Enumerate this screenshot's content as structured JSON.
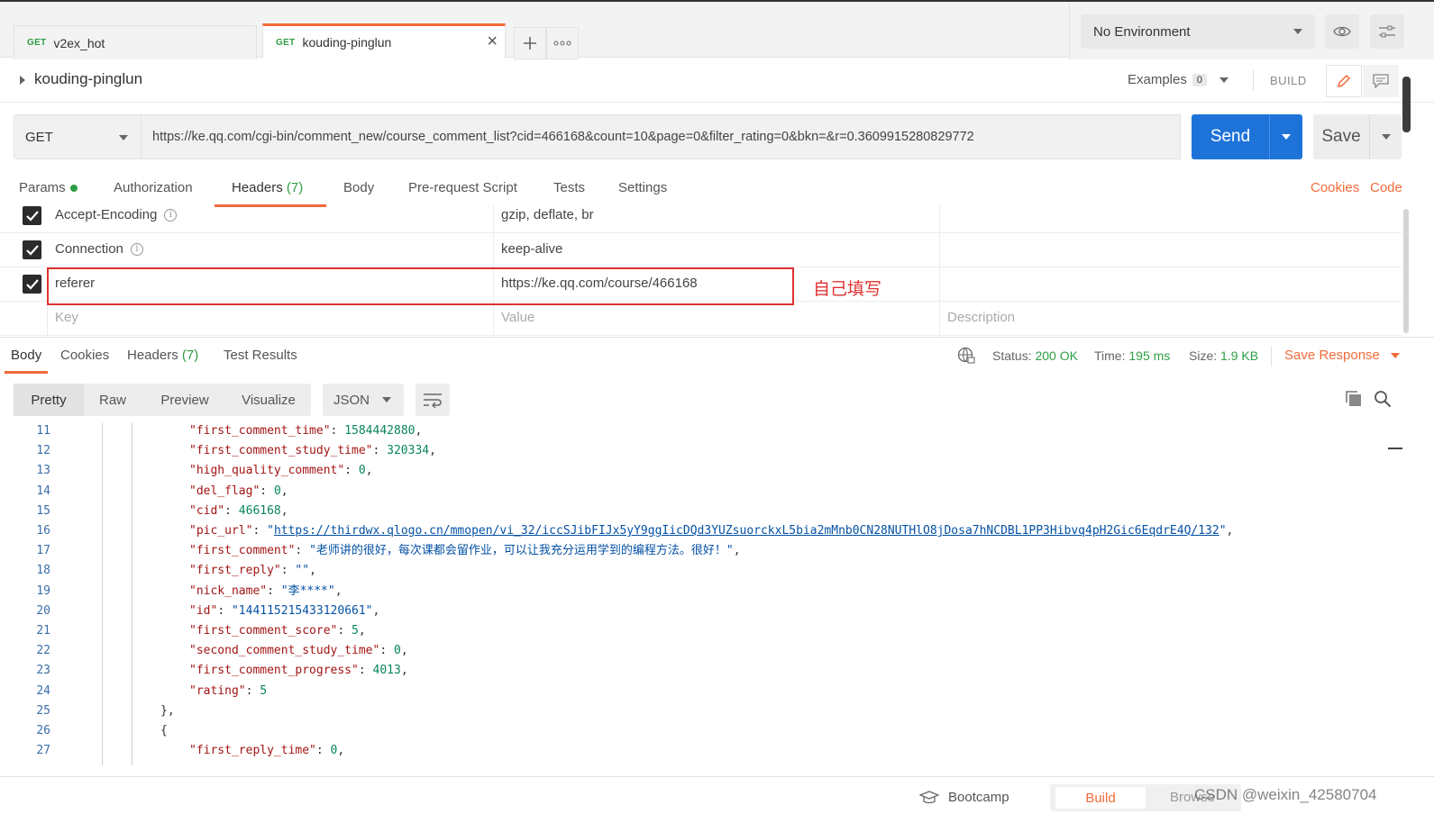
{
  "tabs": [
    {
      "method": "GET",
      "name": "v2ex_hot"
    },
    {
      "method": "GET",
      "name": "kouding-pinglun"
    }
  ],
  "environment": {
    "selected": "No Environment"
  },
  "request": {
    "title": "kouding-pinglun",
    "examples_label": "Examples",
    "examples_count": "0",
    "build_label": "BUILD",
    "method": "GET",
    "url": "https://ke.qq.com/cgi-bin/comment_new/course_comment_list?cid=466168&count=10&page=0&filter_rating=0&bkn=&r=0.3609915280829772",
    "send_label": "Send",
    "save_label": "Save"
  },
  "req_tabs": {
    "params": "Params",
    "authorization": "Authorization",
    "headers": "Headers",
    "headers_count": "(7)",
    "body": "Body",
    "prerequest": "Pre-request Script",
    "tests": "Tests",
    "settings": "Settings",
    "cookies": "Cookies",
    "code": "Code"
  },
  "headers": [
    {
      "key": "Accept-Encoding",
      "value": "gzip, deflate, br"
    },
    {
      "key": "Connection",
      "value": "keep-alive"
    },
    {
      "key": "referer",
      "value": "https://ke.qq.com/course/466168"
    }
  ],
  "headers_placeholder": {
    "key": "Key",
    "value": "Value",
    "description": "Description"
  },
  "annotation": "自己填写",
  "response": {
    "tabs": {
      "body": "Body",
      "cookies": "Cookies",
      "headers": "Headers",
      "headers_count": "(7)",
      "tests": "Test Results"
    },
    "status_label": "Status:",
    "status_value": "200 OK",
    "time_label": "Time:",
    "time_value": "195 ms",
    "size_label": "Size:",
    "size_value": "1.9 KB",
    "save_response": "Save Response",
    "format_buttons": [
      "Pretty",
      "Raw",
      "Preview",
      "Visualize"
    ],
    "language": "JSON"
  },
  "code_lines": [
    {
      "n": "11",
      "key": "\"first_comment_time\"",
      "val": "1584442880",
      "type": "num"
    },
    {
      "n": "12",
      "key": "\"first_comment_study_time\"",
      "val": "320334",
      "type": "num"
    },
    {
      "n": "13",
      "key": "\"high_quality_comment\"",
      "val": "0",
      "type": "num"
    },
    {
      "n": "14",
      "key": "\"del_flag\"",
      "val": "0",
      "type": "num"
    },
    {
      "n": "15",
      "key": "\"cid\"",
      "val": "466168",
      "type": "num"
    },
    {
      "n": "16",
      "key": "\"pic_url\"",
      "val": "https://thirdwx.qlogo.cn/mmopen/vi_32/iccSJibFIJx5yY9ggIicDQd3YUZsuorckxL5bia2mMnb0CN28NUTHlO8jDosa7hNCDBL1PP3Hibvq4pH2Gic6EqdrE4Q/132",
      "type": "link"
    },
    {
      "n": "17",
      "key": "\"first_comment\"",
      "val": "\"老师讲的很好，每次课都会留作业，可以让我充分运用学到的编程方法。很好！\"",
      "type": "str"
    },
    {
      "n": "18",
      "key": "\"first_reply\"",
      "val": "\"\"",
      "type": "str"
    },
    {
      "n": "19",
      "key": "\"nick_name\"",
      "val": "\"李****\"",
      "type": "str"
    },
    {
      "n": "20",
      "key": "\"id\"",
      "val": "\"144115215433120661\"",
      "type": "str"
    },
    {
      "n": "21",
      "key": "\"first_comment_score\"",
      "val": "5",
      "type": "num"
    },
    {
      "n": "22",
      "key": "\"second_comment_study_time\"",
      "val": "0",
      "type": "num"
    },
    {
      "n": "23",
      "key": "\"first_comment_progress\"",
      "val": "4013",
      "type": "num"
    },
    {
      "n": "24",
      "key": "\"rating\"",
      "val": "5",
      "type": "last"
    },
    {
      "n": "25",
      "key": "",
      "val": "},",
      "type": "brace"
    },
    {
      "n": "26",
      "key": "",
      "val": "{",
      "type": "brace"
    },
    {
      "n": "27",
      "key": "\"first_reply_time\"",
      "val": "0",
      "type": "num"
    }
  ],
  "footer": {
    "bootcamp": "Bootcamp",
    "build": "Build",
    "browse": "Browse",
    "watermark": "CSDN @weixin_42580704"
  },
  "icons": [
    "eye-icon",
    "settings-sliders-icon",
    "pencil-icon",
    "comment-icon",
    "globe-icon",
    "copy-icon",
    "search-icon",
    "wrap-lines-icon",
    "graduation-cap-icon",
    "plus-icon",
    "more-icon",
    "close-icon",
    "info-icon",
    "checkbox-checked-icon"
  ],
  "colors": {
    "accent": "#f26b3a",
    "send": "#1e73d8",
    "ok": "#2f9e44",
    "annotation": "#e03131"
  }
}
